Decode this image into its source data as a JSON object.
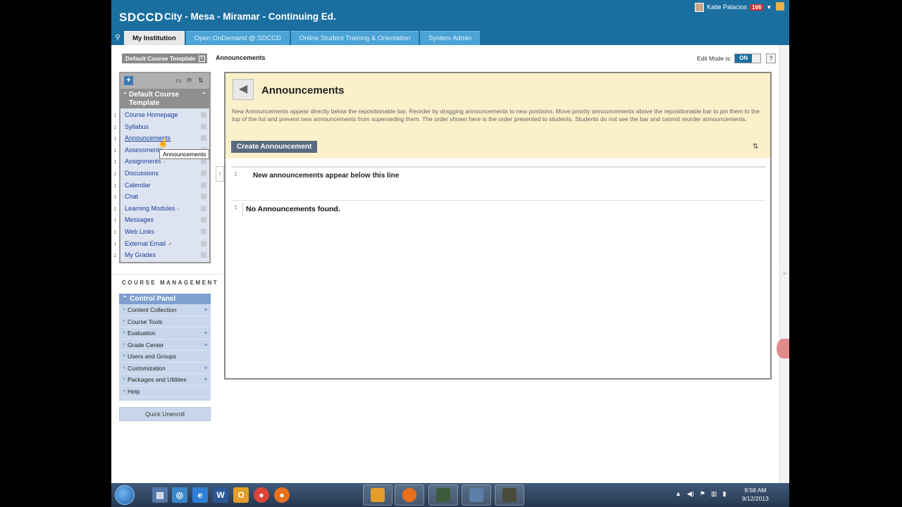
{
  "header": {
    "logo": "SDCCD",
    "institution": "City - Mesa - Miramar - Continuing Ed.",
    "user_name": "Katie Palacios",
    "notification_count": "166"
  },
  "tabs": [
    {
      "label": "My Institution",
      "active": true
    },
    {
      "label": "Open OnDemand @ SDCCD",
      "active": false
    },
    {
      "label": "Online Student Training & Orientation",
      "active": false
    },
    {
      "label": "System Admin",
      "active": false
    }
  ],
  "breadcrumb": {
    "course": "Default Course Template",
    "current": "Announcements"
  },
  "edit_mode": {
    "label": "Edit Mode is:",
    "state": "ON",
    "help": "?"
  },
  "course_menu": {
    "title": "Default Course Template",
    "items": [
      {
        "label": "Course Homepage"
      },
      {
        "label": "Syllabus"
      },
      {
        "label": "Announcements"
      },
      {
        "label": "Assessments"
      },
      {
        "label": "Assignments"
      },
      {
        "label": "Discussions"
      },
      {
        "label": "Calendar"
      },
      {
        "label": "Chat"
      },
      {
        "label": "Learning Modules"
      },
      {
        "label": "Messages"
      },
      {
        "label": "Web Links"
      },
      {
        "label": "External Email"
      },
      {
        "label": "My Grades"
      }
    ],
    "tooltip": "Announcements"
  },
  "course_management": {
    "heading": "COURSE MANAGEMENT",
    "control_panel_title": "Control Panel",
    "items": [
      {
        "label": "Content Collection"
      },
      {
        "label": "Course Tools"
      },
      {
        "label": "Evaluation"
      },
      {
        "label": "Grade Center"
      },
      {
        "label": "Users and Groups"
      },
      {
        "label": "Customization"
      },
      {
        "label": "Packages and Utilities"
      },
      {
        "label": "Help"
      }
    ],
    "quick_unenroll": "Quick Unenroll"
  },
  "content": {
    "title": "Announcements",
    "help_text": "New Announcements appear directly below the repositionable bar. Reorder by dragging announcements to new positions. Move priority announcements above the repositionable bar to pin them to the top of the list and prevent new announcements from superseding them. The order shown here is the order presented to students. Students do not see the bar and cannot reorder announcements.",
    "create_button": "Create Announcement",
    "repositionable_bar": "New announcements appear below this line",
    "empty_message": "No Announcements found."
  },
  "taskbar": {
    "time": "9:58 AM",
    "date": "9/12/2013"
  },
  "colors": {
    "header_blue": "#1a6fa0",
    "tab_blue": "#4ba3d6",
    "content_header_bg": "#faf0c9",
    "control_panel_blue": "#7f9fcf"
  }
}
